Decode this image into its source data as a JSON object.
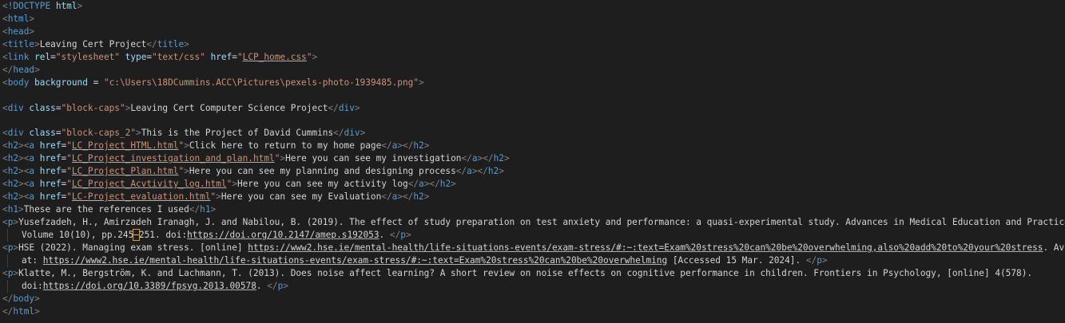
{
  "colors": {
    "background": "#1e1e1e",
    "tag_bracket": "#808080",
    "tag_name": "#569cd6",
    "attr_name": "#9cdcfe",
    "attr_value": "#ce9178",
    "text": "#d4d4d4"
  },
  "code": {
    "doctype_kw": "!DOCTYPE",
    "doctype_val": "html",
    "title_text": "Leaving Cert Project",
    "link_rel": "\"stylesheet\"",
    "link_type": "\"text/css\"",
    "link_href": "LCP_home.css",
    "body_bg": "\"c:\\Users\\18DCummins.ACC\\Pictures\\pexels-photo-1939485.png\"",
    "div1_class": "\"block-caps\"",
    "div1_text": "Leaving Cert Computer Science Project",
    "div2_class": "\"block-caps_2\"",
    "div2_text": "This is the Project of David Cummins",
    "links": [
      {
        "href": "LC_Project_HTML.html",
        "text": "Click here to return to my home page"
      },
      {
        "href": "LC_Project_investigation_and_plan.html",
        "text": "Here you can see my investigation"
      },
      {
        "href": "LC_Project_Plan.html",
        "text": "Here you can see my planning and designing process"
      },
      {
        "href": "LC_Project_Acvtivity_log.html",
        "text": "Here you can see my activity log"
      },
      {
        "href": "LC-Project_evaluation.html",
        "text": "Here you can see my Evaluation"
      }
    ],
    "h1_text": "These are the references I used",
    "ref1_line1": "Yusefzadeh, H., Amirzadeh Iranagh, J. and Nabilou, B. (2019). The effect of study preparation on test anxiety and performance: a quasi-experimental study. Advances in Medical Education and Practice,",
    "ref1_line2_a": "Volume 10(10), pp.245",
    "ref1_line2_b": "–",
    "ref1_line2_c": "251. doi:",
    "ref1_link": "https://doi.org/10.2147/amep.s192053",
    "ref1_end": ". ",
    "ref2_line1_a": "HSE (2022). Managing exam stress. [online] ",
    "ref2_link1": "https://www2.hse.ie/mental-health/life-situations-events/exam-stress/#:~:text=Exam%20stress%20can%20be%20overwhelming,also%20add%20to%20your%20stress",
    "ref2_line1_b": ". Available",
    "ref2_line2_a": "at: ",
    "ref2_link2": "https://www2.hse.ie/mental-health/life-situations-events/exam-stress/#:~:text=Exam%20stress%20can%20be%20overwhelming",
    "ref2_line2_b": " [Accessed 15 Mar. 2024]. ",
    "ref3_line1": "Klatte, M., Bergström, K. and Lachmann, T. (2013). Does noise affect learning? A short review on noise effects on cognitive performance in children. Frontiers in Psychology, [online] 4(578).",
    "ref3_line2_a": "doi:",
    "ref3_link": "https://doi.org/10.3389/fpsyg.2013.00578",
    "ref3_end": ". "
  }
}
